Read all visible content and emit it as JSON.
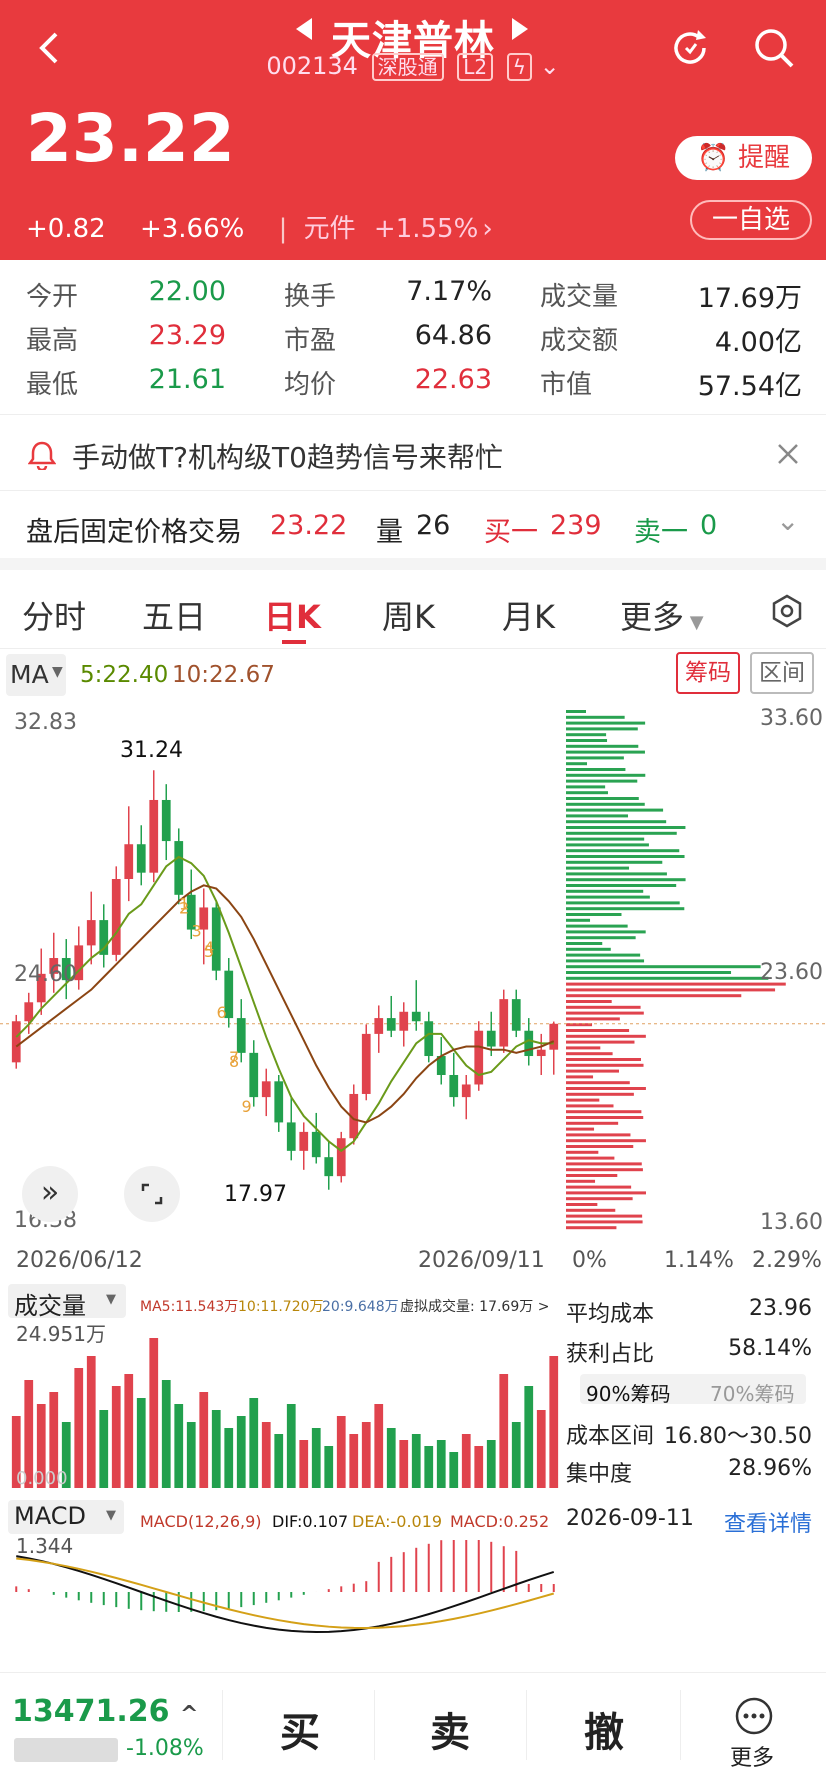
{
  "header": {
    "title": "天津普林",
    "code": "002134",
    "tag_market": "深股通",
    "tag_level": "L2",
    "price": "23.22",
    "change": "+0.82",
    "change_pct": "+3.66%",
    "sector": "元件",
    "sector_pct": "+1.55%",
    "remind": "提醒",
    "watch": "一自选"
  },
  "stats": [
    {
      "label": "今开",
      "value": "22.00",
      "color": "green"
    },
    {
      "label": "换手",
      "value": "7.17%",
      "color": "black"
    },
    {
      "label": "成交量",
      "value": "17.69万",
      "color": "black"
    },
    {
      "label": "最高",
      "value": "23.29",
      "color": "red"
    },
    {
      "label": "市盈",
      "value": "64.86",
      "color": "black"
    },
    {
      "label": "成交额",
      "value": "4.00亿",
      "color": "black"
    },
    {
      "label": "最低",
      "value": "21.61",
      "color": "green"
    },
    {
      "label": "均价",
      "value": "22.63",
      "color": "red"
    },
    {
      "label": "市值",
      "value": "57.54亿",
      "color": "black"
    }
  ],
  "banner": {
    "text": "手动做T?机构级T0趋势信号来帮忙"
  },
  "after_hours": {
    "label": "盘后固定价格交易",
    "price": "23.22",
    "vol_label": "量",
    "vol": "26",
    "buy_label": "买一",
    "buy": "239",
    "sell_label": "卖一",
    "sell": "0"
  },
  "tabs": [
    "分时",
    "五日",
    "日K",
    "周K",
    "月K",
    "更多"
  ],
  "active_tab": "日K",
  "ma": {
    "label": "MA",
    "ma5": "5:22.40",
    "ma10": "10:22.67",
    "chip_btn": "筹码",
    "range_btn": "区间"
  },
  "kline": {
    "y_top": "32.83",
    "y_mid": "24.60",
    "y_bot": "16.38",
    "high_mark": "31.24",
    "low_mark": "17.97",
    "date_start": "2026/06/12",
    "date_end": "2026/09/11",
    "chip_top": "33.60",
    "chip_mid": "23.60",
    "chip_bot": "13.60",
    "chip_x0": "0%",
    "chip_x1": "1.14%",
    "chip_x2": "2.29%",
    "seq": [
      "1",
      "2",
      "3",
      "4",
      "5",
      "6",
      "7",
      "8",
      "9"
    ]
  },
  "volume": {
    "label": "成交量",
    "ma5": "MA5:11.543万",
    "ma10": "10:11.720万",
    "ma20": "20:9.648万",
    "virtual": "虚拟成交量: 17.69万 >",
    "max": "24.951万",
    "min": "0.000"
  },
  "macd": {
    "label": "MACD",
    "params": "MACD(12,26,9)",
    "dif": "DIF:0.107",
    "dea": "DEA:-0.019",
    "macd": "MACD:0.252",
    "top": "1.344"
  },
  "chip_stats": {
    "avg_cost_label": "平均成本",
    "avg_cost": "23.96",
    "profit_label": "获利占比",
    "profit": "58.14%",
    "c90": "90%筹码",
    "c70": "70%筹码",
    "range_label": "成本区间",
    "range": "16.80～30.50",
    "conc_label": "集中度",
    "conc": "28.96%",
    "date": "2026-09-11",
    "detail": "查看详情"
  },
  "bottom": {
    "index_value": "13471.26",
    "index_pct": "-1.08%",
    "buy": "买",
    "sell": "卖",
    "cancel": "撤",
    "more": "更多"
  },
  "chart_data": {
    "type": "candlestick",
    "x_start": "2026/06/12",
    "x_end": "2026/09/11",
    "ylim": [
      16.38,
      32.83
    ],
    "candles": [
      [
        22.0,
        23.5,
        21.8,
        23.3
      ],
      [
        23.3,
        24.2,
        22.9,
        23.9
      ],
      [
        23.9,
        25.6,
        23.5,
        24.8
      ],
      [
        24.8,
        26.1,
        24.2,
        25.3
      ],
      [
        25.3,
        25.9,
        24.0,
        24.6
      ],
      [
        24.6,
        26.3,
        24.3,
        25.7
      ],
      [
        25.7,
        27.4,
        25.1,
        26.5
      ],
      [
        26.5,
        27.0,
        25.0,
        25.4
      ],
      [
        25.4,
        28.2,
        25.2,
        27.8
      ],
      [
        27.8,
        30.1,
        27.1,
        28.9
      ],
      [
        28.9,
        29.5,
        27.6,
        28.0
      ],
      [
        28.0,
        31.24,
        27.7,
        30.3
      ],
      [
        30.3,
        30.8,
        28.4,
        29.0
      ],
      [
        29.0,
        29.4,
        27.0,
        27.3
      ],
      [
        27.3,
        28.1,
        25.9,
        26.2
      ],
      [
        26.2,
        27.5,
        25.1,
        26.9
      ],
      [
        26.9,
        27.1,
        24.6,
        24.9
      ],
      [
        24.9,
        25.3,
        23.1,
        23.4
      ],
      [
        23.4,
        24.0,
        22.0,
        22.3
      ],
      [
        22.3,
        22.7,
        20.6,
        20.9
      ],
      [
        20.9,
        21.8,
        20.3,
        21.4
      ],
      [
        21.4,
        21.6,
        19.8,
        20.1
      ],
      [
        20.1,
        20.9,
        18.9,
        19.2
      ],
      [
        19.2,
        20.1,
        18.6,
        19.8
      ],
      [
        19.8,
        20.4,
        18.8,
        19.0
      ],
      [
        19.0,
        19.5,
        17.97,
        18.4
      ],
      [
        18.4,
        19.8,
        18.2,
        19.6
      ],
      [
        19.6,
        21.3,
        19.4,
        21.0
      ],
      [
        21.0,
        23.2,
        20.8,
        22.9
      ],
      [
        22.9,
        23.8,
        22.3,
        23.4
      ],
      [
        23.4,
        24.1,
        22.8,
        23.0
      ],
      [
        23.0,
        23.9,
        22.5,
        23.6
      ],
      [
        23.6,
        24.6,
        23.0,
        23.3
      ],
      [
        23.3,
        23.6,
        22.0,
        22.2
      ],
      [
        22.2,
        22.8,
        21.3,
        21.6
      ],
      [
        21.6,
        22.3,
        20.6,
        20.9
      ],
      [
        20.9,
        21.6,
        20.2,
        21.3
      ],
      [
        21.3,
        23.3,
        21.1,
        23.0
      ],
      [
        23.0,
        23.6,
        22.2,
        22.5
      ],
      [
        22.5,
        24.3,
        22.3,
        24.0
      ],
      [
        24.0,
        24.3,
        22.8,
        23.0
      ],
      [
        23.0,
        23.4,
        21.9,
        22.2
      ],
      [
        22.2,
        22.9,
        21.6,
        22.4
      ],
      [
        22.4,
        23.29,
        21.61,
        23.22
      ]
    ],
    "ma5": [
      22.8,
      23.2,
      23.7,
      24.1,
      24.5,
      24.9,
      25.3,
      25.6,
      26.1,
      26.7,
      27.0,
      27.6,
      28.2,
      28.5,
      28.3,
      27.9,
      27.1,
      26.1,
      25.0,
      23.9,
      22.8,
      21.8,
      20.9,
      20.3,
      19.9,
      19.5,
      19.2,
      19.5,
      20.1,
      20.7,
      21.4,
      22.0,
      22.6,
      22.9,
      22.9,
      22.4,
      21.9,
      21.6,
      21.7,
      22.1,
      22.5,
      22.7,
      22.6,
      22.6
    ],
    "ma10": [
      22.5,
      22.8,
      23.1,
      23.4,
      23.7,
      24.0,
      24.3,
      24.7,
      25.1,
      25.5,
      25.9,
      26.3,
      26.7,
      27.1,
      27.4,
      27.6,
      27.5,
      27.1,
      26.6,
      25.9,
      25.1,
      24.3,
      23.5,
      22.7,
      21.9,
      21.2,
      20.6,
      20.2,
      20.1,
      20.3,
      20.6,
      21.0,
      21.5,
      21.9,
      22.2,
      22.4,
      22.5,
      22.5,
      22.4,
      22.4,
      22.3,
      22.4,
      22.5,
      22.67
    ]
  }
}
